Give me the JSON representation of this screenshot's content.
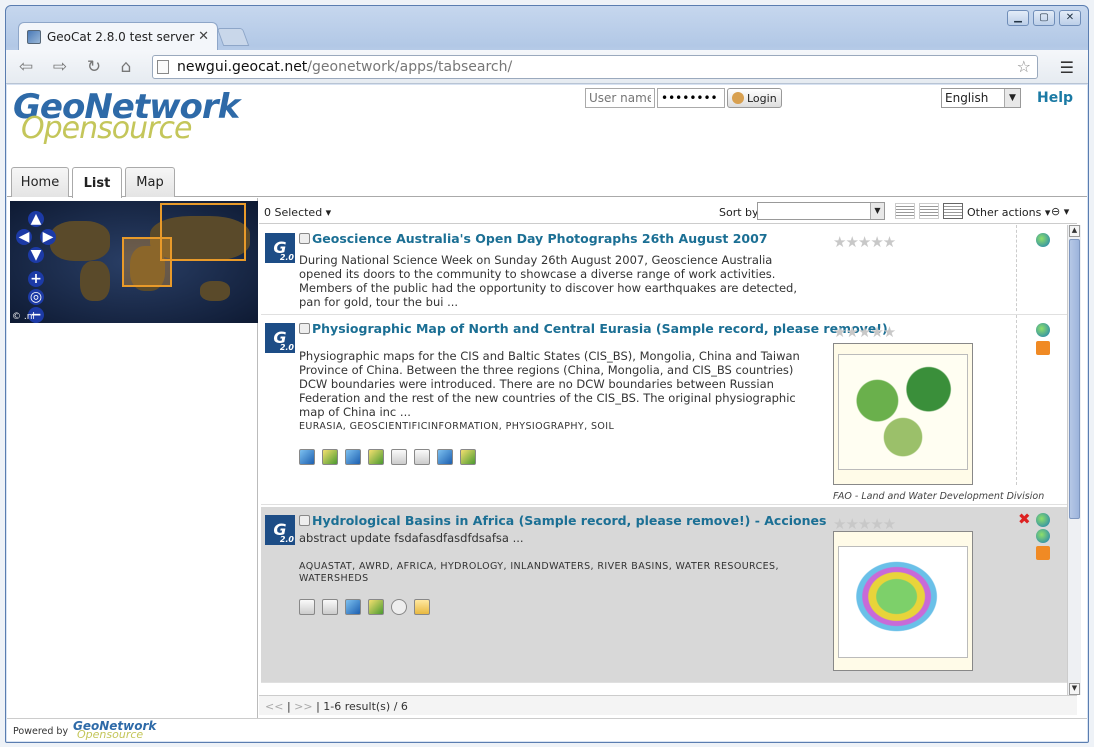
{
  "browser": {
    "tab_title": "GeoCat 2.8.0 test server",
    "url_host": "newgui.geocat.net",
    "url_path": "/geonetwork/apps/tabsearch/"
  },
  "header": {
    "logo_line1": "GeoNetwork",
    "logo_line2": "Opensource",
    "username_placeholder": "User name",
    "password_value": "••••••••",
    "login_label": "Login",
    "language": "English",
    "help": "Help"
  },
  "tabs": [
    {
      "label": "Home"
    },
    {
      "label": "List"
    },
    {
      "label": "Map"
    }
  ],
  "map": {
    "credit": "© .nl"
  },
  "results_toolbar": {
    "selected": "0 Selected ▾",
    "sort_label": "Sort by",
    "other_actions": "Other actions ▾",
    "link_icon": "⊖ ▾"
  },
  "records": [
    {
      "title": "Geoscience Australia's Open Day Photographs 26th August 2007",
      "abstract": "During National Science Week on Sunday 26th August 2007, Geoscience Australia opened its doors to the community to showcase a diverse range of work activities. Members of the public had the opportunity to discover how earthquakes are detected, pan for gold, tour the bui ..."
    },
    {
      "title": "Physiographic Map of North and Central Eurasia (Sample record, please remove!)",
      "abstract": "Physiographic maps for the CIS and Baltic States (CIS_BS), Mongolia, China and Taiwan Province of China. Between the three regions (China, Mongolia, and CIS_BS countries) DCW boundaries were introduced. There are no DCW boundaries between Russian Federation and the rest of the new countries of the CIS_BS. The original physiographic map of China inc ...",
      "keywords": "EURASIA, GEOSCIENTIFICINFORMATION, PHYSIOGRAPHY, SOIL",
      "caption": "FAO - Land and Water Development Division"
    },
    {
      "title": "Hydrological Basins in Africa (Sample record, please remove!) - Acciones",
      "abstract": "abstract update fsdafasdfasdfdsafsa ...",
      "keywords": "AQUASTAT, AWRD, AFRICA, HYDROLOGY, INLANDWATERS, RIVER BASINS, WATER RESOURCES, WATERSHEDS"
    }
  ],
  "pager": {
    "prev": "<<",
    "sep": "|",
    "next": ">>",
    "summary": "| 1-6 result(s) / 6"
  },
  "footer": {
    "powered": "Powered by",
    "logo1": "GeoNetwork",
    "logo2": "Opensource"
  }
}
